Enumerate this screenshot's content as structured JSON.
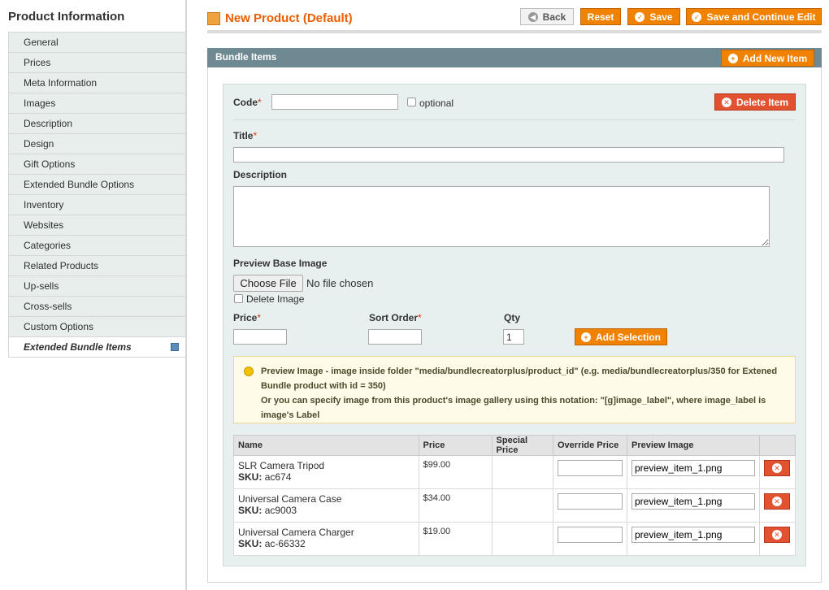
{
  "sidebar": {
    "title": "Product Information",
    "items": [
      {
        "label": "General"
      },
      {
        "label": "Prices"
      },
      {
        "label": "Meta Information"
      },
      {
        "label": "Images"
      },
      {
        "label": "Description"
      },
      {
        "label": "Design"
      },
      {
        "label": "Gift Options"
      },
      {
        "label": "Extended Bundle Options"
      },
      {
        "label": "Inventory"
      },
      {
        "label": "Websites"
      },
      {
        "label": "Categories"
      },
      {
        "label": "Related Products"
      },
      {
        "label": "Up-sells"
      },
      {
        "label": "Cross-sells"
      },
      {
        "label": "Custom Options"
      },
      {
        "label": "Extended Bundle Items"
      }
    ],
    "active_item": "Extended Bundle Items"
  },
  "header": {
    "title": "New Product (Default)",
    "back_label": "Back",
    "reset_label": "Reset",
    "save_label": "Save",
    "save_continue_label": "Save and Continue Edit"
  },
  "bundle": {
    "section_title": "Bundle Items",
    "add_item_label": "Add New Item",
    "delete_item_label": "Delete Item",
    "code_label": "Code",
    "code_value": "",
    "optional_label": "optional",
    "title_label": "Title",
    "title_value": "",
    "description_label": "Description",
    "description_value": "",
    "preview_label": "Preview Base Image",
    "choose_file_label": "Choose File",
    "no_file_label": "No file chosen",
    "delete_image_label": "Delete Image",
    "price_label": "Price",
    "price_value": "",
    "sort_label": "Sort Order",
    "sort_value": "",
    "qty_label": "Qty",
    "qty_value": "1",
    "add_selection_label": "Add Selection",
    "required_mark": "*",
    "note_line1": "Preview Image - image inside folder \"media/bundlecreatorplus/product_id\" (e.g. media/bundlecreatorplus/350 for Extened Bundle product with id = 350)",
    "note_line2": "Or you can specify image from this product's image gallery using this notation: \"[g]image_label\", where image_label is image's Label"
  },
  "table": {
    "columns": [
      "Name",
      "Price",
      "Special Price",
      "Override Price",
      "Preview Image",
      ""
    ],
    "sku_prefix": "SKU:",
    "rows": [
      {
        "name": "SLR Camera Tripod",
        "sku": "ac674",
        "price": "$99.00",
        "special": "",
        "override": "",
        "preview": "preview_item_1.png"
      },
      {
        "name": "Universal Camera Case",
        "sku": "ac9003",
        "price": "$34.00",
        "special": "",
        "override": "",
        "preview": "preview_item_1.png"
      },
      {
        "name": "Universal Camera Charger",
        "sku": "ac-66332",
        "price": "$19.00",
        "special": "",
        "override": "",
        "preview": "preview_item_1.png"
      }
    ]
  }
}
